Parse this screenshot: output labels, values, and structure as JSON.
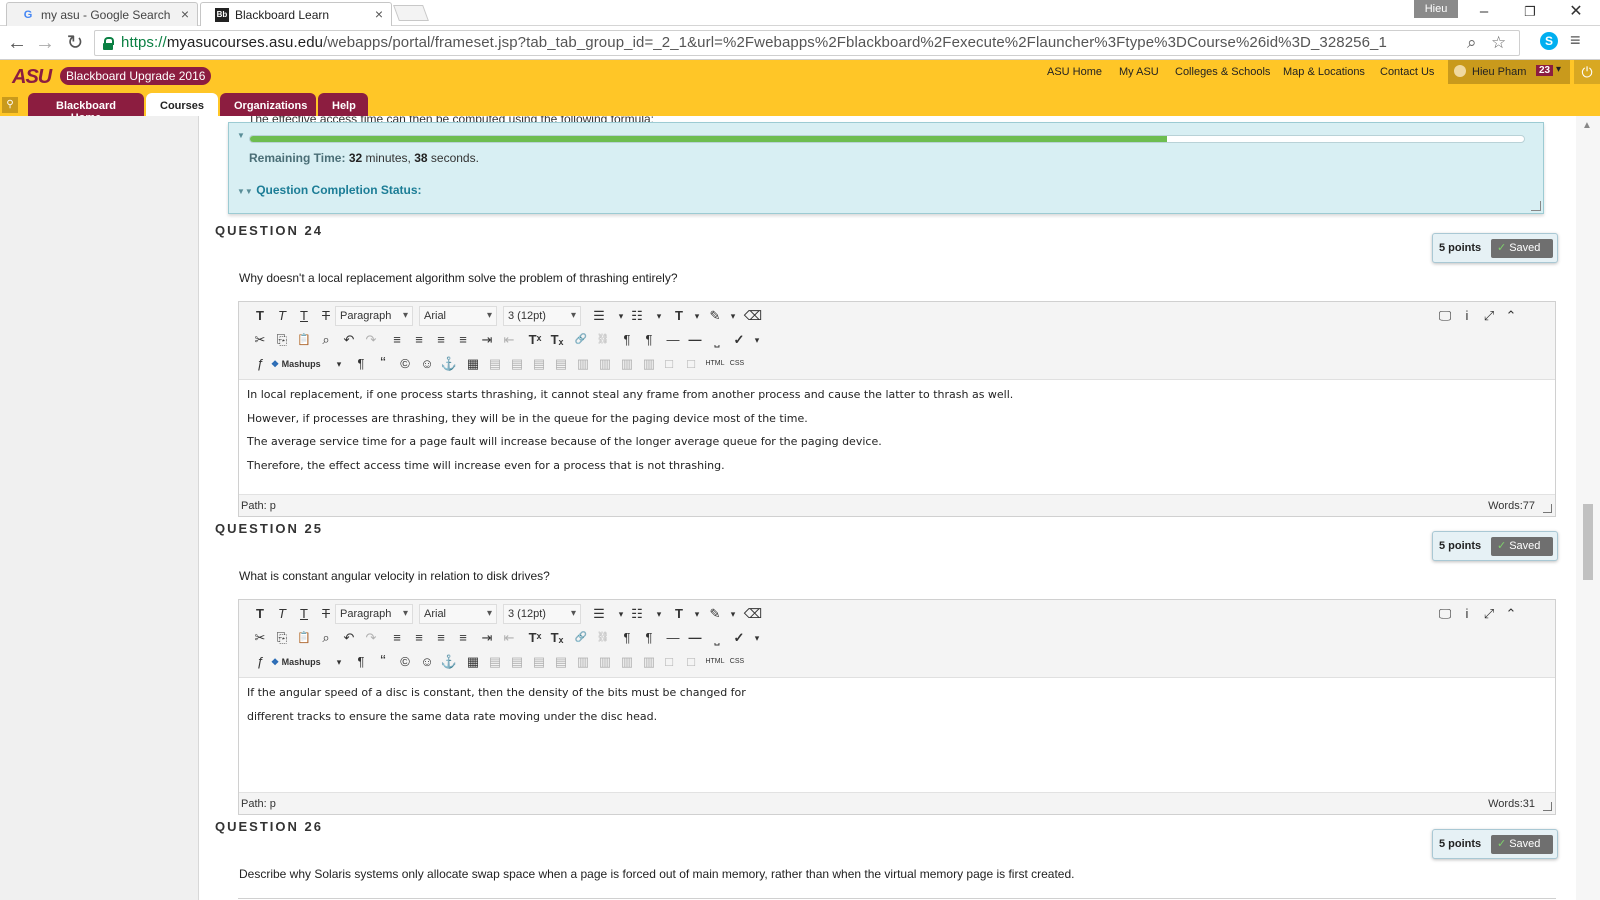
{
  "browser": {
    "tabs": [
      {
        "title": "my asu - Google Search",
        "favicon": "G"
      },
      {
        "title": "Blackboard Learn",
        "favicon": "Bb"
      }
    ],
    "profile_name": "Hieu",
    "url": {
      "scheme": "https://",
      "host": "myasucourses.asu.edu",
      "path": "/webapps/portal/frameset.jsp?tab_tab_group_id=_2_1&url=%2Fwebapps%2Fblackboard%2Fexecute%2Flauncher%3Ftype%3DCourse%26id%3D_328256_1"
    }
  },
  "header": {
    "logo": "ASU",
    "upgrade_badge": "Blackboard Upgrade 2016",
    "links": [
      "ASU Home",
      "My ASU",
      "Colleges & Schools",
      "Map & Locations",
      "Contact Us"
    ],
    "user_name": "Hieu Pham",
    "notification_count": "23",
    "tabs": [
      "Blackboard Home",
      "Courses",
      "Organizations",
      "Help"
    ],
    "active_tab": "Courses"
  },
  "status_panel": {
    "clipped_text": "The effective access time can then be computed using the following formula:",
    "progress_fraction": 0.72,
    "remaining_label": "Remaining Time:",
    "remaining_minutes": "32",
    "minutes_label": " minutes, ",
    "remaining_seconds": "38",
    "seconds_label": " seconds.",
    "completion_label": "Question Completion Status:"
  },
  "editor_toolbar": {
    "paragraph": "Paragraph",
    "font": "Arial",
    "size": "3 (12pt)",
    "mashups": "Mashups",
    "html_label": "HTML",
    "css_label": "CSS"
  },
  "questions": [
    {
      "title": "QUESTION 24",
      "points": "5 points",
      "saved": "Saved",
      "prompt": "Why doesn't a local replacement algorithm solve the problem of thrashing entirely?",
      "answer_lines": [
        "In local replacement, if one process starts thrashing, it cannot steal any frame from another process and cause the latter to thrash as well.",
        "However, if processes are thrashing, they will be in the queue for the paging device most of the time.",
        "The average service time for a page fault will increase because of the longer average queue for the paging device.",
        "Therefore, the effect access time will increase even for a process that is not thrashing."
      ],
      "path": "Path: p",
      "words": "Words:77"
    },
    {
      "title": "QUESTION 25",
      "points": "5 points",
      "saved": "Saved",
      "prompt": "What is constant angular velocity in relation to disk drives?",
      "answer_lines": [
        "If the angular speed of a disc is constant, then the density of the bits must be changed for",
        "different tracks to ensure the same data rate moving under the disc head."
      ],
      "path": "Path: p",
      "words": "Words:31"
    },
    {
      "title": "QUESTION 26",
      "points": "5 points",
      "saved": "Saved",
      "prompt": "Describe why Solaris systems only allocate swap space when a page is forced out of main memory, rather than when the virtual memory page is first created."
    }
  ]
}
